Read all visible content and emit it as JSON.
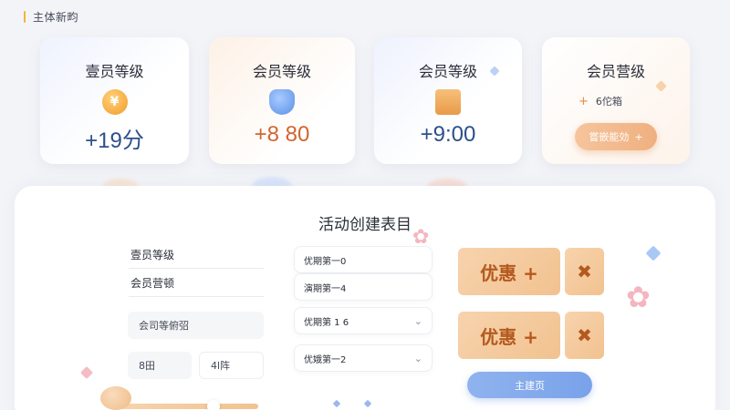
{
  "header": {
    "title": "主体新畇"
  },
  "cards": [
    {
      "title": "壹员等级",
      "icon": "coin-icon",
      "glyph": "¥",
      "value": "+19分"
    },
    {
      "title": "会员等级",
      "icon": "shield-icon",
      "glyph": "",
      "value": "+8 80"
    },
    {
      "title": "会员等级",
      "icon": "gift-icon",
      "glyph": "",
      "value": "+9:00"
    },
    {
      "title": "会员营级",
      "line_plus": "+",
      "line_text": "6佗箱",
      "button": "嘗嵌能効",
      "button_plus": "+"
    }
  ],
  "panel": {
    "title": "活动创建表目",
    "left": {
      "row1": "壹员等级",
      "row2": "会员营顿",
      "box1": "会司等俯弨",
      "box2a": "8田",
      "box2b": "4l阵"
    },
    "dropdowns": [
      {
        "text": "优期第一0",
        "chevron": ""
      },
      {
        "text": "演期第一4",
        "chevron": ""
      },
      {
        "text": "优期第 1 6",
        "chevron": "⌄"
      },
      {
        "text": "优娥第一2",
        "chevron": "⌄"
      }
    ],
    "coupons": [
      {
        "label": "优惠 +",
        "stub": "✖"
      },
      {
        "label": "优惠 +",
        "stub": "✖"
      }
    ],
    "main_button": "主建页"
  },
  "colors": {
    "accent_blue": "#7aa2ea",
    "accent_orange": "#f2c290",
    "value_blue": "#2d4f8c",
    "value_orange": "#d0662f"
  }
}
